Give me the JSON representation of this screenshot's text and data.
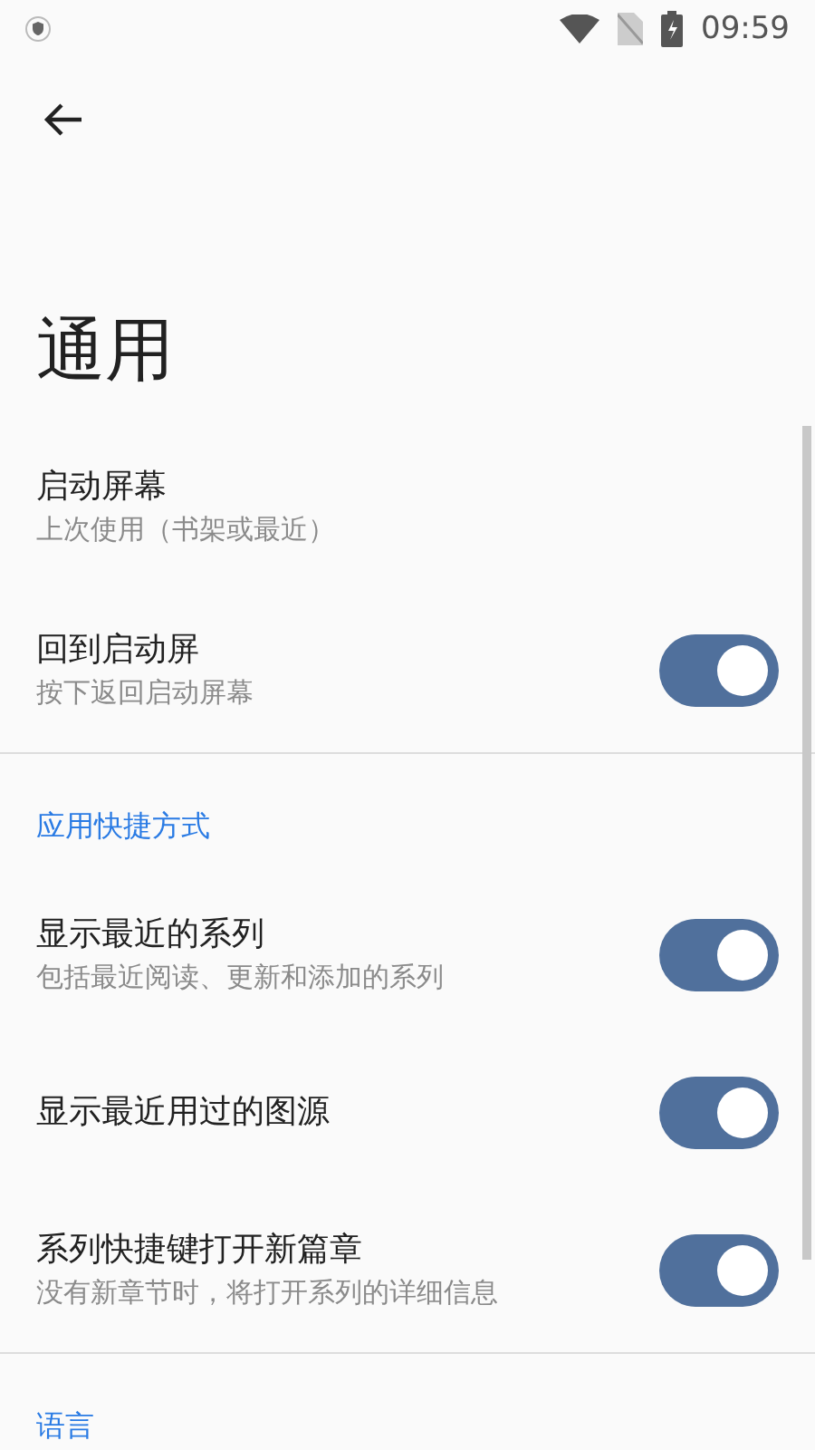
{
  "status_bar": {
    "time": "09:59"
  },
  "page": {
    "title": "通用"
  },
  "sections": [
    {
      "items": [
        {
          "kind": "text",
          "title": "启动屏幕",
          "subtitle": "上次使用（书架或最近）"
        },
        {
          "kind": "switch",
          "title": "回到启动屏",
          "subtitle": "按下返回启动屏幕",
          "on": true
        }
      ]
    },
    {
      "header": "应用快捷方式",
      "items": [
        {
          "kind": "switch",
          "title": "显示最近的系列",
          "subtitle": "包括最近阅读、更新和添加的系列",
          "on": true
        },
        {
          "kind": "switch",
          "title": "显示最近用过的图源",
          "on": true
        },
        {
          "kind": "switch",
          "title": "系列快捷键打开新篇章",
          "subtitle": "没有新章节时，将打开系列的详细信息",
          "on": true
        }
      ]
    },
    {
      "header": "语言"
    }
  ]
}
